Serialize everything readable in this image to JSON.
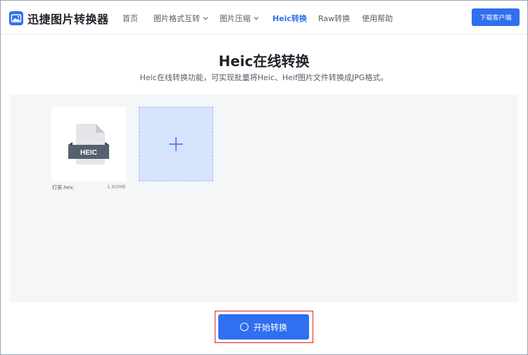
{
  "header": {
    "brand": "迅捷图片转换器",
    "nav": [
      {
        "label": "首页"
      },
      {
        "label": "图片格式互转"
      },
      {
        "label": "图片压缩"
      },
      {
        "label": "Heic转换"
      },
      {
        "label": "Raw转换"
      },
      {
        "label": "使用帮助"
      }
    ],
    "download_label": "下载客户端"
  },
  "page": {
    "title": "Heic在线转换",
    "subtitle": "Heic在线转换功能，可实现批量将Heic、Heif图片文件转换成JPG格式。"
  },
  "files": [
    {
      "badge": "HEIC",
      "name": "灯笼.heic",
      "size": "1.80MB"
    }
  ],
  "start_button": {
    "label": "开始转换"
  },
  "colors": {
    "accent": "#2f6ff0",
    "highlight_frame": "#e02020",
    "work_area_bg": "#f5f6f8",
    "add_tile_bg": "#d6e4fe"
  }
}
